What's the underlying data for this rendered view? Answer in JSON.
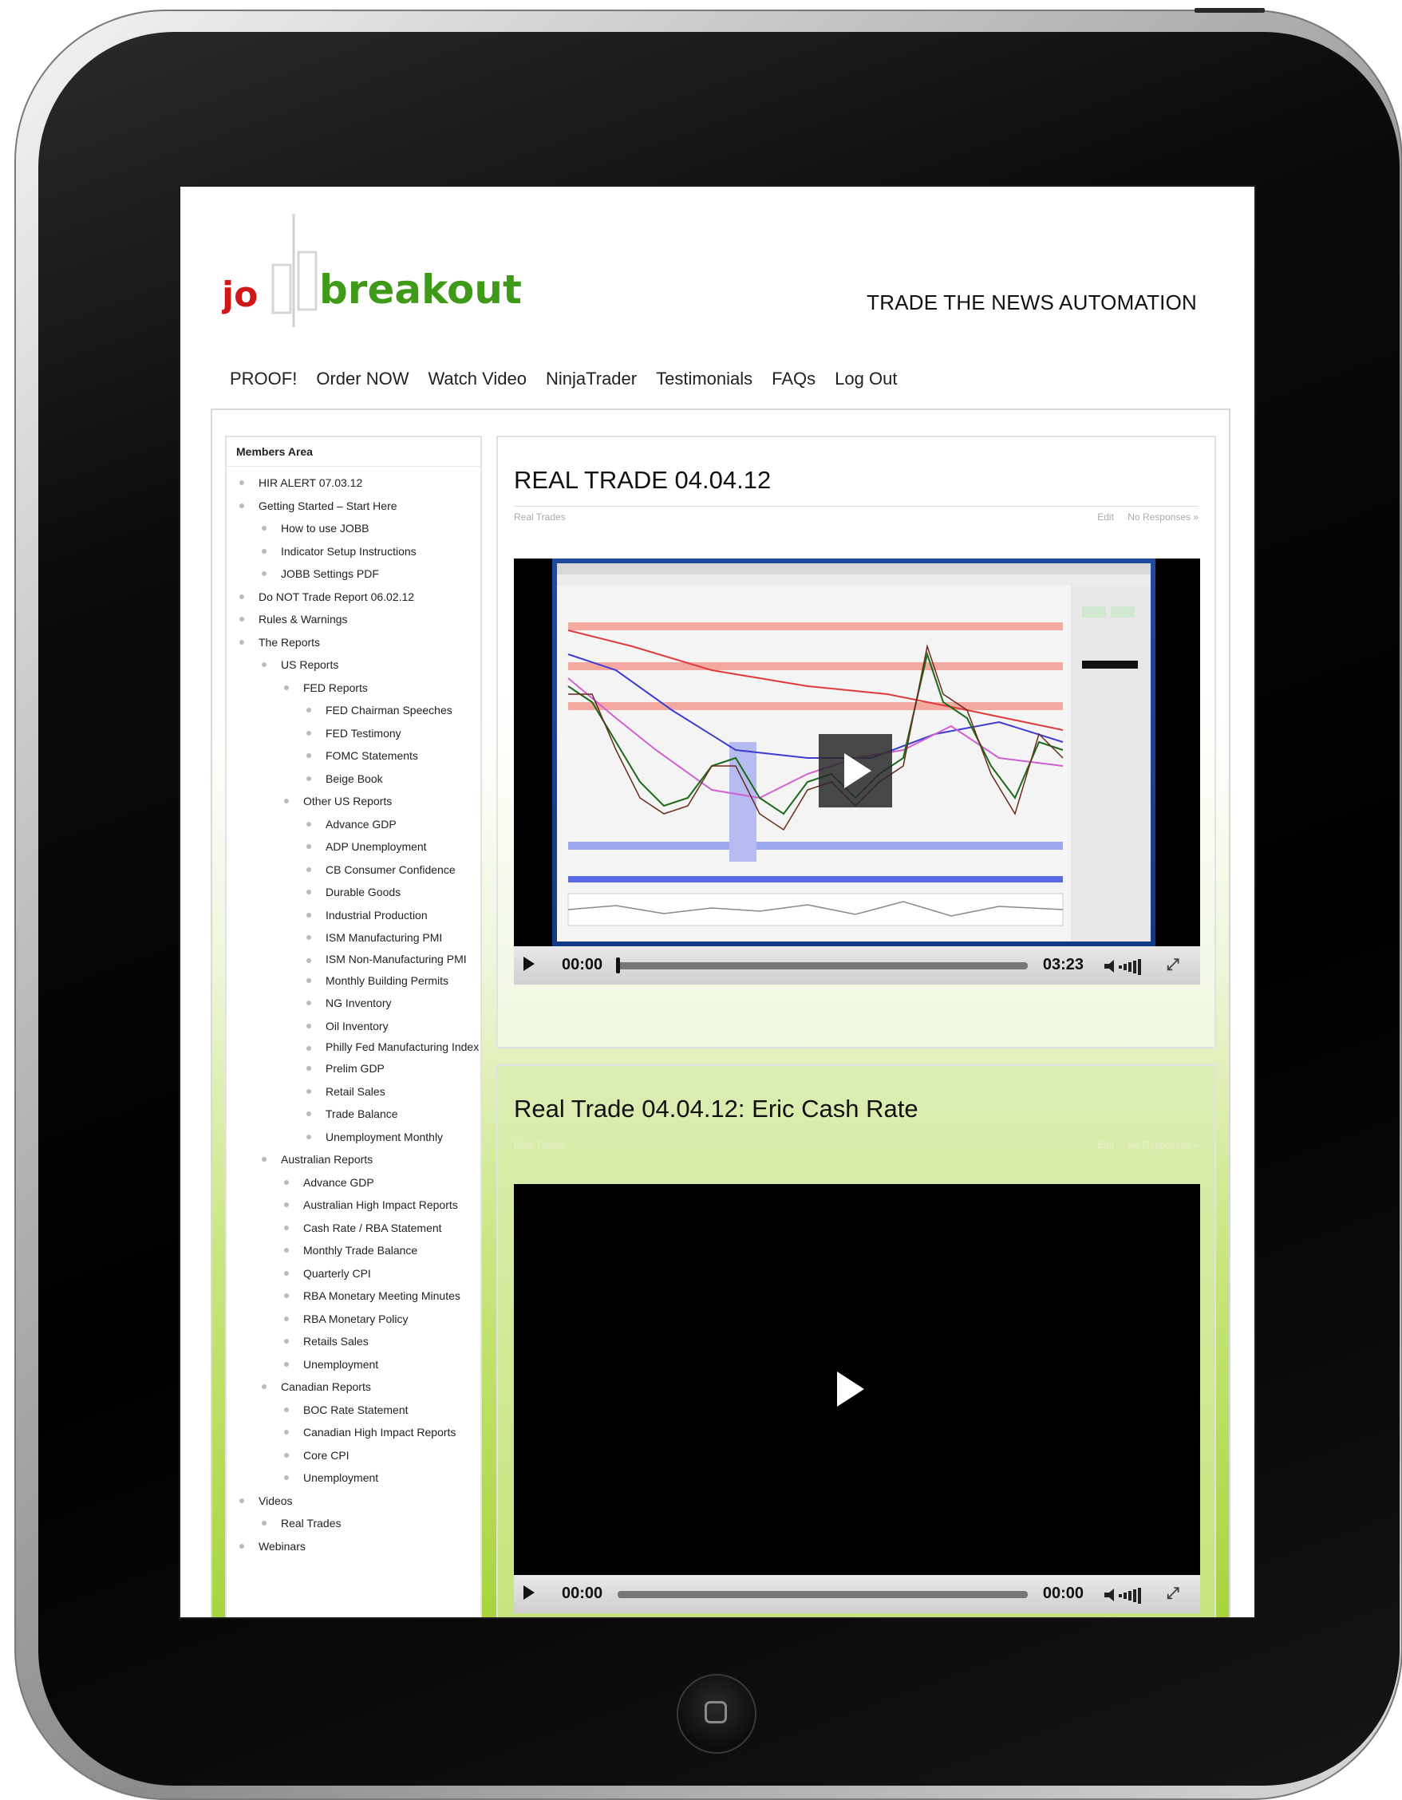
{
  "site": {
    "logo_left": "jo",
    "logo_right": "breakout",
    "tagline": "TRADE THE NEWS AUTOMATION"
  },
  "nav": [
    "PROOF!",
    "Order NOW",
    "Watch Video",
    "NinjaTrader",
    "Testimonials",
    "FAQs",
    "Log Out"
  ],
  "sidebar": {
    "title": "Members Area",
    "items": [
      {
        "label": "HIR ALERT 07.03.12",
        "depth": 0
      },
      {
        "label": "Getting Started – Start Here",
        "depth": 0
      },
      {
        "label": "How to use JOBB",
        "depth": 1
      },
      {
        "label": "Indicator Setup Instructions",
        "depth": 1
      },
      {
        "label": "JOBB Settings PDF",
        "depth": 1
      },
      {
        "label": "Do NOT Trade Report 06.02.12",
        "depth": 0
      },
      {
        "label": "Rules & Warnings",
        "depth": 0
      },
      {
        "label": "The Reports",
        "depth": 0
      },
      {
        "label": "US Reports",
        "depth": 1
      },
      {
        "label": "FED Reports",
        "depth": 2
      },
      {
        "label": "FED Chairman Speeches",
        "depth": 3
      },
      {
        "label": "FED Testimony",
        "depth": 3
      },
      {
        "label": "FOMC Statements",
        "depth": 3
      },
      {
        "label": "Beige Book",
        "depth": 3
      },
      {
        "label": "Other US Reports",
        "depth": 2
      },
      {
        "label": "Advance GDP",
        "depth": 3
      },
      {
        "label": "ADP Unemployment",
        "depth": 3
      },
      {
        "label": "CB Consumer Confidence",
        "depth": 3
      },
      {
        "label": "Durable Goods",
        "depth": 3
      },
      {
        "label": "Industrial Production",
        "depth": 3
      },
      {
        "label": "ISM Manufacturing PMI",
        "depth": 3
      },
      {
        "label": "ISM Non-Manufacturing PMI",
        "depth": 3,
        "wrap": true
      },
      {
        "label": "Monthly Building Permits",
        "depth": 3
      },
      {
        "label": "NG Inventory",
        "depth": 3
      },
      {
        "label": "Oil Inventory",
        "depth": 3
      },
      {
        "label": "Philly Fed Manufacturing Index",
        "depth": 3,
        "wrap": true
      },
      {
        "label": "Prelim GDP",
        "depth": 3
      },
      {
        "label": "Retail Sales",
        "depth": 3
      },
      {
        "label": "Trade Balance",
        "depth": 3
      },
      {
        "label": "Unemployment Monthly",
        "depth": 3
      },
      {
        "label": "Australian Reports",
        "depth": 1
      },
      {
        "label": "Advance GDP",
        "depth": 2
      },
      {
        "label": "Australian High Impact Reports",
        "depth": 2
      },
      {
        "label": "Cash Rate / RBA Statement",
        "depth": 2
      },
      {
        "label": "Monthly Trade Balance",
        "depth": 2
      },
      {
        "label": "Quarterly CPI",
        "depth": 2
      },
      {
        "label": "RBA Monetary Meeting Minutes",
        "depth": 2
      },
      {
        "label": "RBA Monetary Policy",
        "depth": 2
      },
      {
        "label": "Retails Sales",
        "depth": 2
      },
      {
        "label": "Unemployment",
        "depth": 2
      },
      {
        "label": "Canadian Reports",
        "depth": 1
      },
      {
        "label": "BOC Rate Statement",
        "depth": 2
      },
      {
        "label": "Canadian High Impact Reports",
        "depth": 2
      },
      {
        "label": "Core CPI",
        "depth": 2
      },
      {
        "label": "Unemployment",
        "depth": 2
      },
      {
        "label": "Videos",
        "depth": 0
      },
      {
        "label": "Real Trades",
        "depth": 1
      },
      {
        "label": "Webinars",
        "depth": 0
      }
    ]
  },
  "posts": [
    {
      "title": "REAL TRADE 04.04.12",
      "category": "Real Trades",
      "edit": "Edit",
      "responses": "No Responses »",
      "video": {
        "current": "00:00",
        "duration": "03:23",
        "progress": 0.0
      }
    },
    {
      "title": "Real Trade 04.04.12: Eric Cash Rate",
      "category": "Real Trades",
      "edit": "Edit",
      "responses": "No Responses »",
      "video": {
        "current": "00:00",
        "duration": "00:00",
        "progress": 0.0
      }
    }
  ],
  "colors": {
    "logo_red": "#d01818",
    "logo_green": "#3f9a1a",
    "page_green": "#a6d43a"
  }
}
